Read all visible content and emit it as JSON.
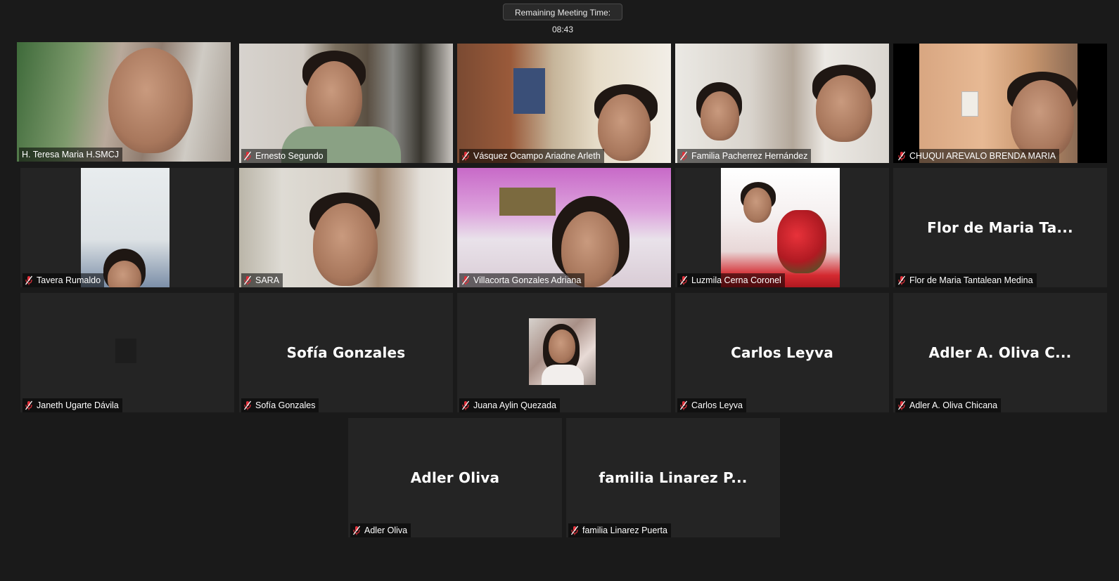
{
  "meeting": {
    "remaining_time_label": "Remaining Meeting Time: 08:43"
  },
  "participants": [
    {
      "name": "H. Teresa Maria H.SMCJ",
      "muted": false,
      "video": true,
      "active_speaker": true
    },
    {
      "name": "Ernesto Segundo",
      "muted": true,
      "video": true
    },
    {
      "name": "Vásquez Ocampo Ariadne Arleth",
      "muted": true,
      "video": true
    },
    {
      "name": "Familia Pacherrez Hernández",
      "muted": true,
      "video": true
    },
    {
      "name": "CHUQUI AREVALO BRENDA MARIA",
      "muted": true,
      "video": true
    },
    {
      "name": "Tavera Rumaldo",
      "muted": true,
      "video": true
    },
    {
      "name": "SARA",
      "muted": true,
      "video": true
    },
    {
      "name": "Villacorta Gonzales Adriana",
      "muted": true,
      "video": true
    },
    {
      "name": "Luzmila Cerna Coronel",
      "muted": true,
      "video": true
    },
    {
      "name": "Flor de Maria Tantalean Medina",
      "display": "Flor de Maria Ta...",
      "muted": true,
      "video": false
    },
    {
      "name": "Janeth Ugarte Dávila",
      "muted": true,
      "video": false
    },
    {
      "name": "Sofía Gonzales",
      "display": "Sofía Gonzales",
      "muted": true,
      "video": false
    },
    {
      "name": "Juana Aylin Quezada",
      "muted": true,
      "video": false,
      "profile_photo": true
    },
    {
      "name": "Carlos Leyva",
      "display": "Carlos Leyva",
      "muted": true,
      "video": false
    },
    {
      "name": "Adler A. Oliva Chicana",
      "display": "Adler A. Oliva C...",
      "muted": true,
      "video": false
    },
    {
      "name": "Adler Oliva",
      "display": "Adler Oliva",
      "muted": true,
      "video": false
    },
    {
      "name": "familia Linarez Puerta",
      "display": "familia Linarez P...",
      "muted": true,
      "video": false
    }
  ],
  "colors": {
    "background": "#1a1a1a",
    "tile": "#242424",
    "active_speaker_border": "#d6e85a",
    "muted_icon": "#e0303a"
  }
}
